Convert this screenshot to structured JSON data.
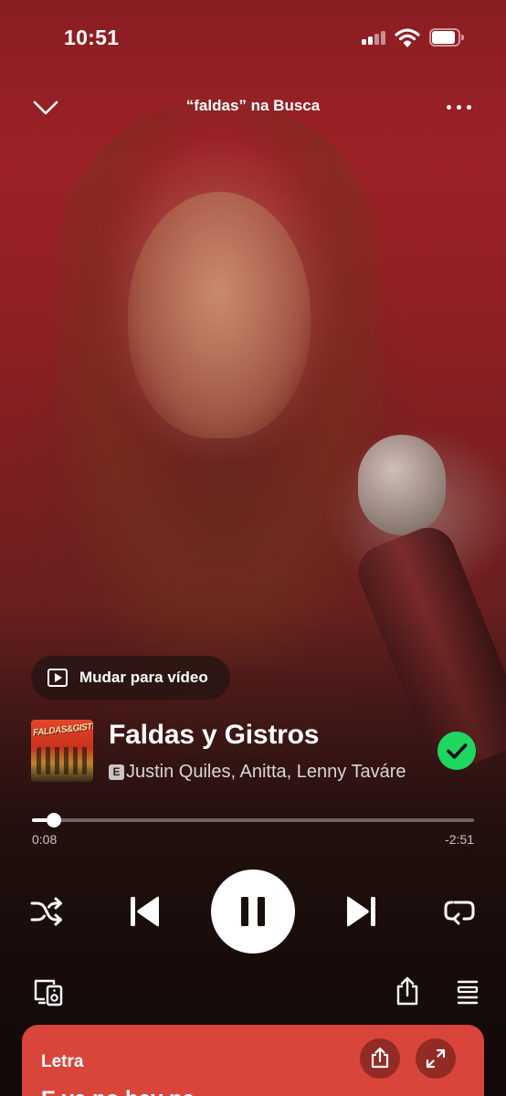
{
  "status_bar": {
    "time": "10:51",
    "signal_bars": 2,
    "wifi": "wifi-icon",
    "battery_level": 0.9
  },
  "header": {
    "context_title": "“faldas” na Busca",
    "collapse_icon": "chevron-down-icon",
    "more_icon": "more-horizontal-icon"
  },
  "video_toggle": {
    "label": "Mudar para vídeo",
    "icon": "video-icon"
  },
  "track": {
    "title": "Faldas y Gistros",
    "explicit_badge": "E",
    "artists": "Justin Quiles, Anitta, Lenny Tavárez",
    "album_art_text": "FALDAS&GISTROS",
    "liked": true
  },
  "progress": {
    "elapsed": "0:08",
    "remaining": "-2:51",
    "fraction": 0.05
  },
  "controls": {
    "shuffle": "shuffle-icon",
    "previous": "skip-previous-icon",
    "play_pause": "pause-icon",
    "next": "skip-next-icon",
    "repeat": "repeat-icon",
    "devices": "devices-icon",
    "share": "share-icon",
    "queue": "queue-icon"
  },
  "lyrics": {
    "title": "Letra",
    "peek_text": "E ya no hay na",
    "share_icon": "share-icon",
    "expand_icon": "expand-icon"
  },
  "colors": {
    "accent_green": "#1ed760",
    "lyrics_card": "#d9453a"
  }
}
